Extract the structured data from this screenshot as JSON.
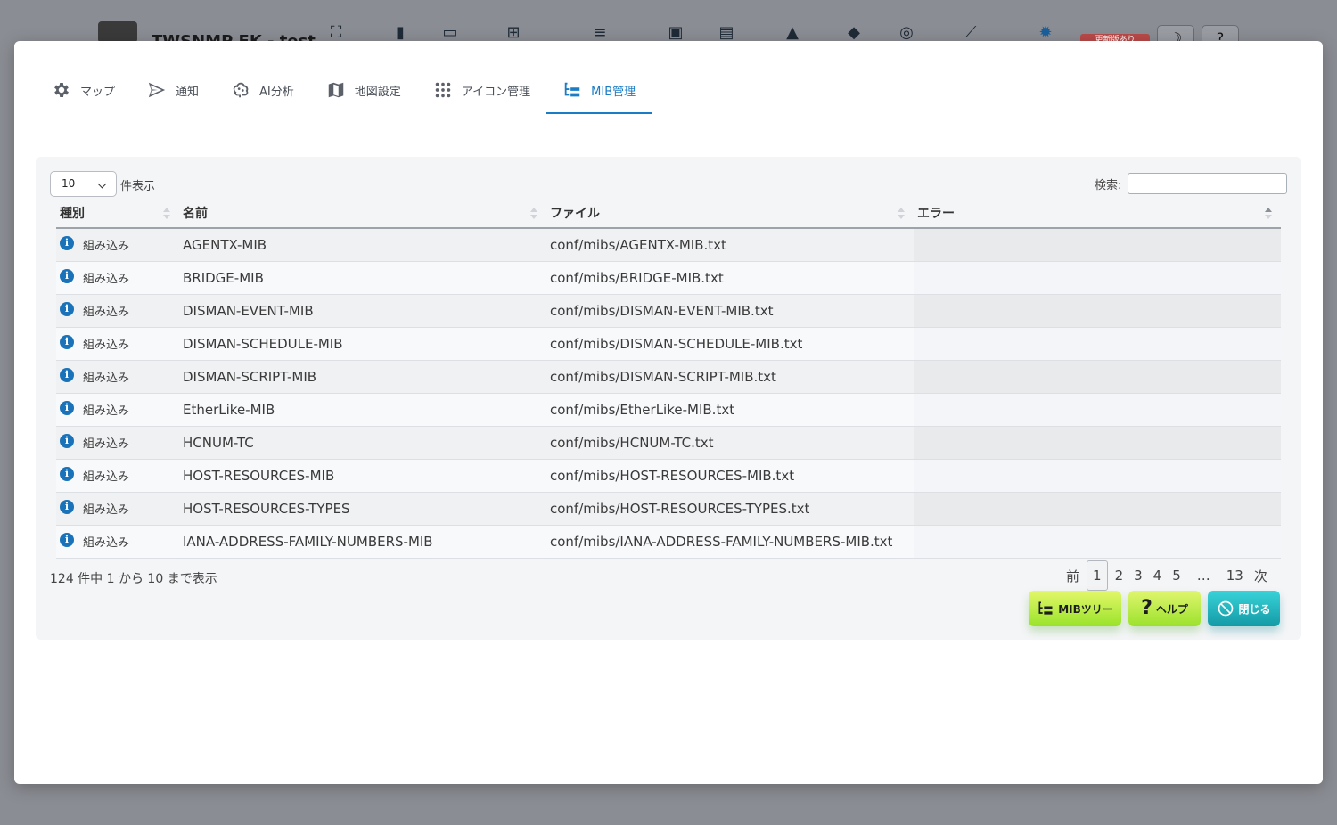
{
  "background": {
    "app_title": "TWSNMP FK - test",
    "badge": "更新版あり",
    "right_buttons": [
      "☽",
      "?"
    ]
  },
  "tabs": [
    {
      "label": "マップ",
      "icon": "gear-icon"
    },
    {
      "label": "通知",
      "icon": "paper-plane-icon"
    },
    {
      "label": "AI分析",
      "icon": "brain-icon"
    },
    {
      "label": "地図設定",
      "icon": "map-icon"
    },
    {
      "label": "アイコン管理",
      "icon": "grid-dots-icon"
    },
    {
      "label": "MIB管理",
      "icon": "tree-icon",
      "active": true
    }
  ],
  "table_controls": {
    "length_value": "10",
    "length_suffix": "件表示",
    "search_label": "検索:",
    "search_value": ""
  },
  "columns": [
    "種別",
    "名前",
    "ファイル",
    "エラー"
  ],
  "rows": [
    {
      "type": "組み込み",
      "name": "AGENTX-MIB",
      "file": "conf/mibs/AGENTX-MIB.txt",
      "error": ""
    },
    {
      "type": "組み込み",
      "name": "BRIDGE-MIB",
      "file": "conf/mibs/BRIDGE-MIB.txt",
      "error": ""
    },
    {
      "type": "組み込み",
      "name": "DISMAN-EVENT-MIB",
      "file": "conf/mibs/DISMAN-EVENT-MIB.txt",
      "error": ""
    },
    {
      "type": "組み込み",
      "name": "DISMAN-SCHEDULE-MIB",
      "file": "conf/mibs/DISMAN-SCHEDULE-MIB.txt",
      "error": ""
    },
    {
      "type": "組み込み",
      "name": "DISMAN-SCRIPT-MIB",
      "file": "conf/mibs/DISMAN-SCRIPT-MIB.txt",
      "error": ""
    },
    {
      "type": "組み込み",
      "name": "EtherLike-MIB",
      "file": "conf/mibs/EtherLike-MIB.txt",
      "error": ""
    },
    {
      "type": "組み込み",
      "name": "HCNUM-TC",
      "file": "conf/mibs/HCNUM-TC.txt",
      "error": ""
    },
    {
      "type": "組み込み",
      "name": "HOST-RESOURCES-MIB",
      "file": "conf/mibs/HOST-RESOURCES-MIB.txt",
      "error": ""
    },
    {
      "type": "組み込み",
      "name": "HOST-RESOURCES-TYPES",
      "file": "conf/mibs/HOST-RESOURCES-TYPES.txt",
      "error": ""
    },
    {
      "type": "組み込み",
      "name": "IANA-ADDRESS-FAMILY-NUMBERS-MIB",
      "file": "conf/mibs/IANA-ADDRESS-FAMILY-NUMBERS-MIB.txt",
      "error": ""
    }
  ],
  "info_text": "124 件中 1 から 10 まで表示",
  "pagination": {
    "prev": "前",
    "pages": [
      "1",
      "2",
      "3",
      "4",
      "5",
      "…",
      "13"
    ],
    "current": "1",
    "next": "次"
  },
  "buttons": {
    "mib_tree": "MIBツリー",
    "help": "ヘルプ",
    "close": "閉じる"
  },
  "colors": {
    "accent": "#1a7cc4",
    "info_icon": "#1a72b8",
    "green_button": "#b8ec45",
    "teal_button": "#22b8c0"
  }
}
